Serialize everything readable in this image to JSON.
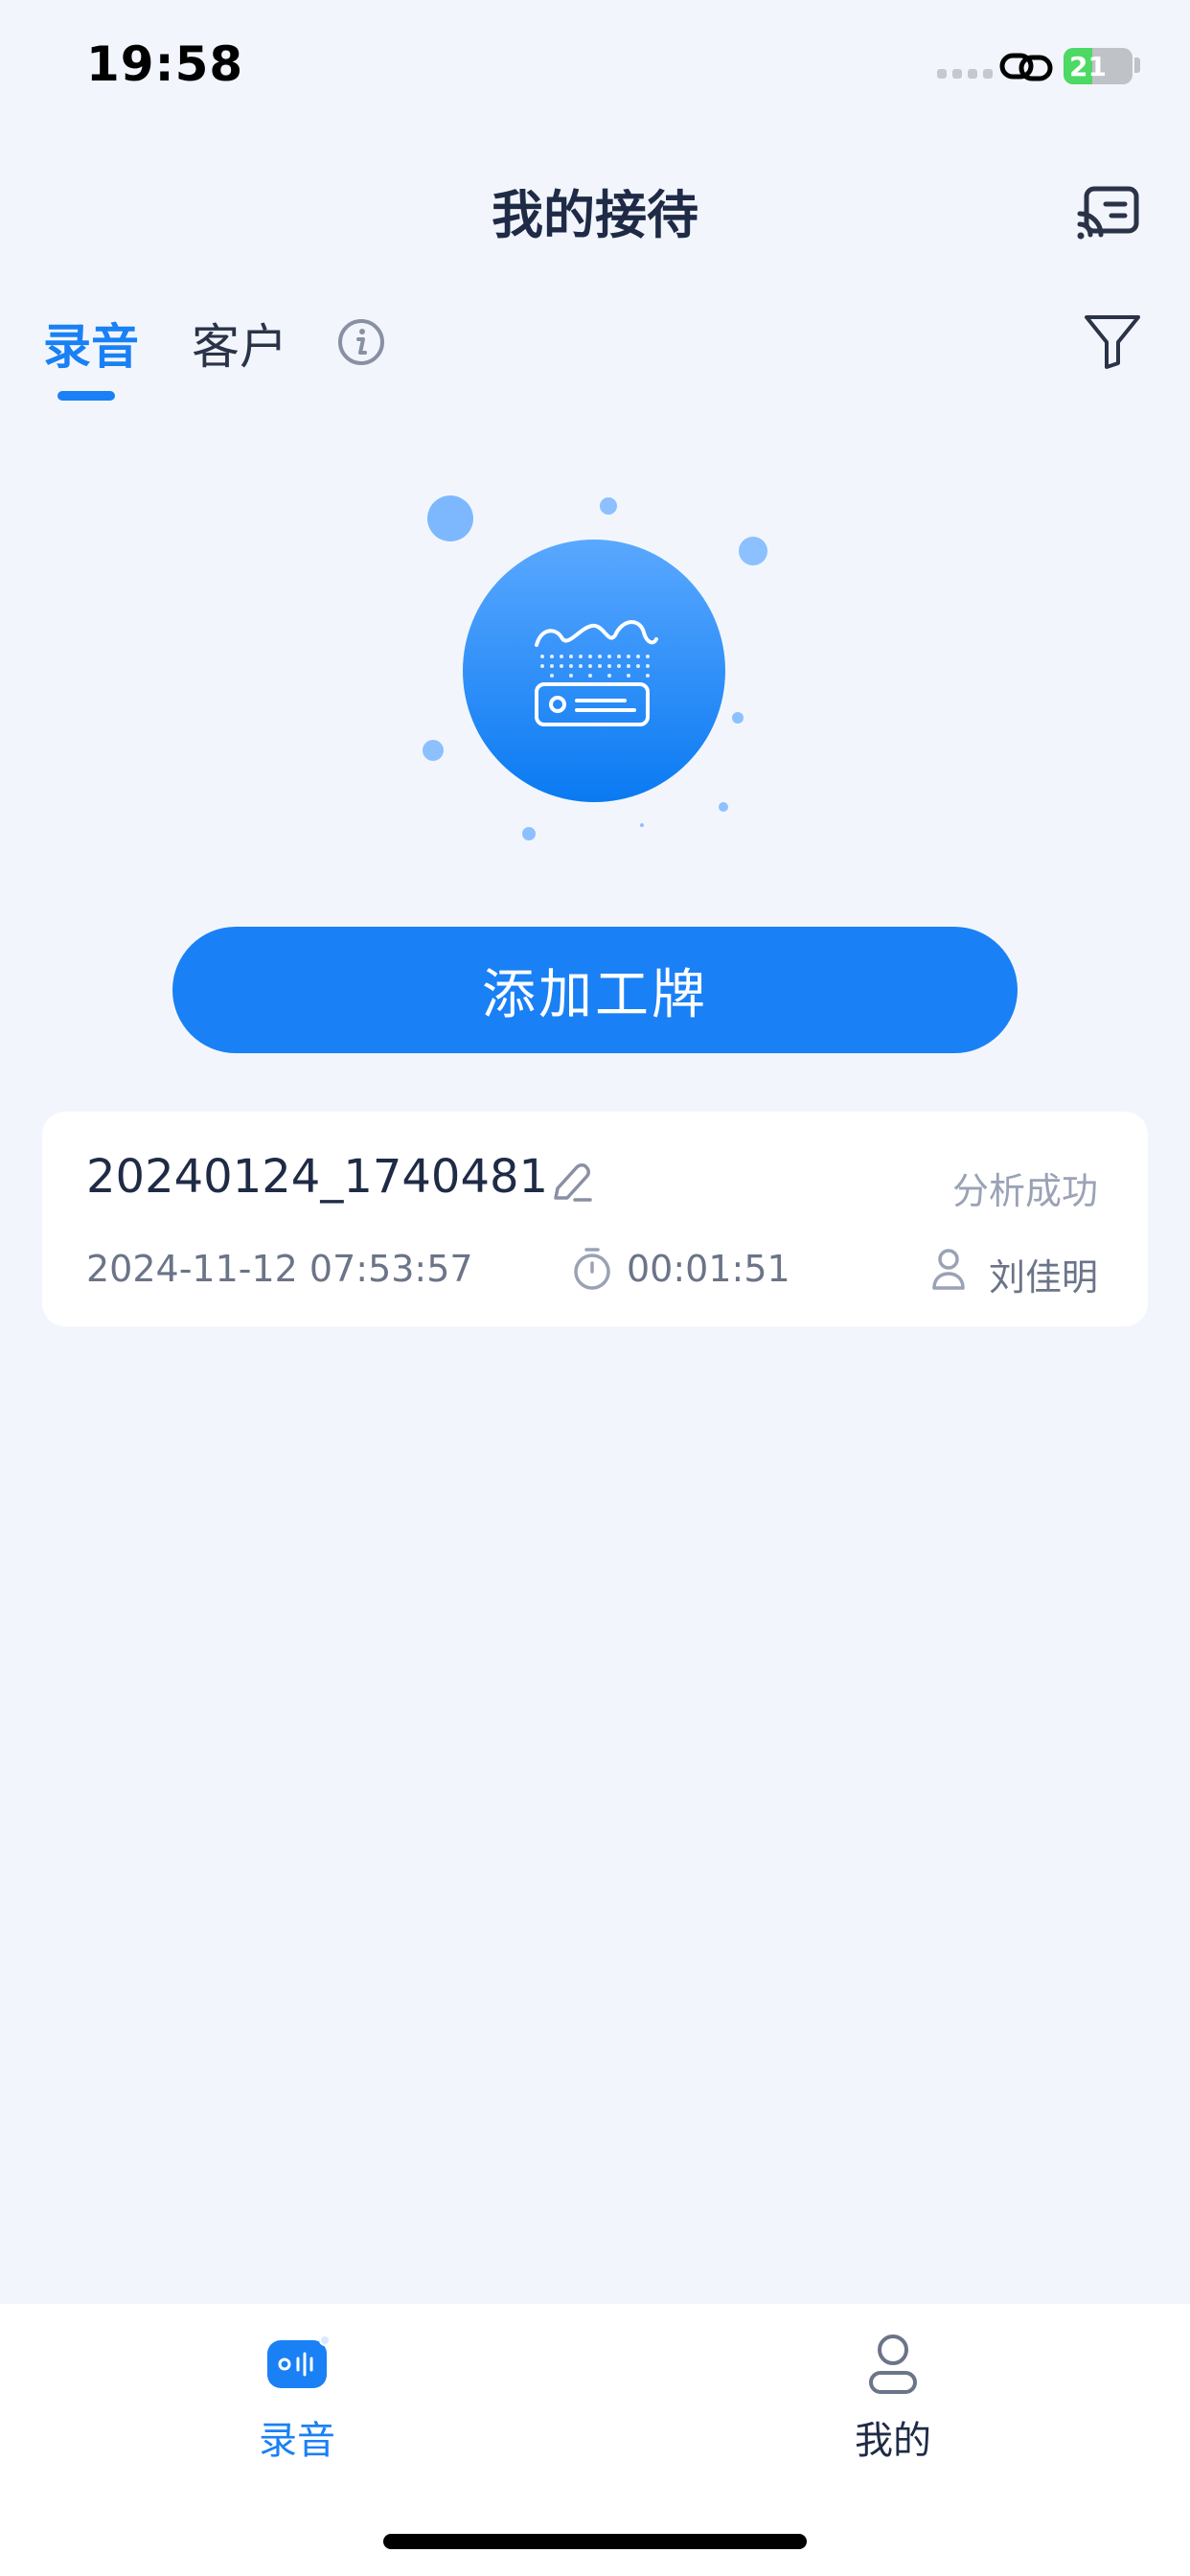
{
  "status_bar": {
    "time": "19:58",
    "battery_level": "21"
  },
  "header": {
    "title": "我的接待",
    "cast_icon": "cast-screen-icon"
  },
  "tabs": [
    {
      "label": "录音",
      "active": true
    },
    {
      "label": "客户",
      "active": false
    }
  ],
  "toolbar": {
    "info_icon": "info-icon",
    "filter_icon": "filter-icon"
  },
  "illustration": {
    "icon": "voice-recorder-icon"
  },
  "actions": {
    "add_badge_label": "添加工牌"
  },
  "records": [
    {
      "name": "20240124_1740481",
      "status": "分析成功",
      "datetime": "2024-11-12 07:53:57",
      "duration": "00:01:51",
      "owner": "刘佳明"
    }
  ],
  "bottom_nav": [
    {
      "label": "录音",
      "icon": "recorder-icon",
      "active": true
    },
    {
      "label": "我的",
      "icon": "user-icon",
      "active": false
    }
  ],
  "colors": {
    "accent": "#1a80f5",
    "background": "#f2f6fc",
    "text_primary": "#1f2b46",
    "text_secondary": "#6b7488",
    "status_muted": "#9aa2b5"
  }
}
